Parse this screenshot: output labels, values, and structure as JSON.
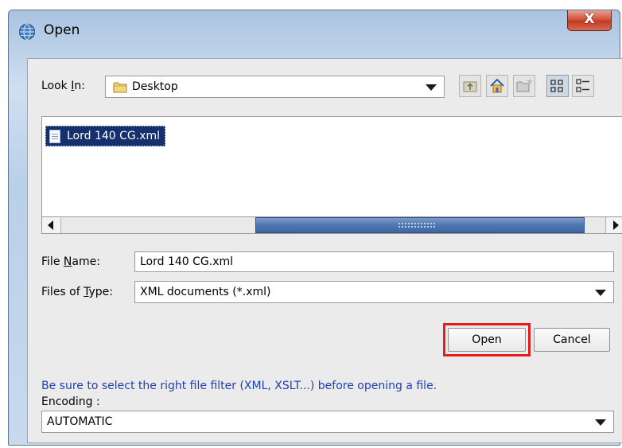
{
  "window": {
    "title": "Open",
    "close_glyph": "X"
  },
  "look_in": {
    "label_prefix": "Look ",
    "label_mnemonic": "I",
    "label_suffix": "n:",
    "value": "Desktop",
    "folder_icon": "folder-icon"
  },
  "toolbar": {
    "buttons": [
      "up-one-level-icon",
      "home-icon",
      "new-folder-icon",
      "list-view-icon",
      "details-view-icon"
    ]
  },
  "file_list": {
    "items": [
      {
        "name": "Lord 140 CG.xml",
        "icon": "xml-file-icon",
        "selected": true
      }
    ]
  },
  "scrollbar": {
    "position": 0.6
  },
  "file_name": {
    "label_prefix": "File ",
    "label_mnemonic": "N",
    "label_suffix": "ame:",
    "value": "Lord 140 CG.xml"
  },
  "files_of_type": {
    "label_prefix": "Files of ",
    "label_mnemonic": "T",
    "label_suffix": "ype:",
    "value": "XML documents (*.xml)"
  },
  "buttons": {
    "open": "Open",
    "cancel": "Cancel"
  },
  "info_text": "Be sure to select the right file filter (XML, XSLT...) before opening a file.",
  "encoding": {
    "label": "Encoding :",
    "value": "AUTOMATIC"
  },
  "colors": {
    "selection": "#15306d",
    "highlight_box": "#e02020",
    "info_text": "#1f3fb5",
    "scroll_thumb": "#4f76b0"
  }
}
